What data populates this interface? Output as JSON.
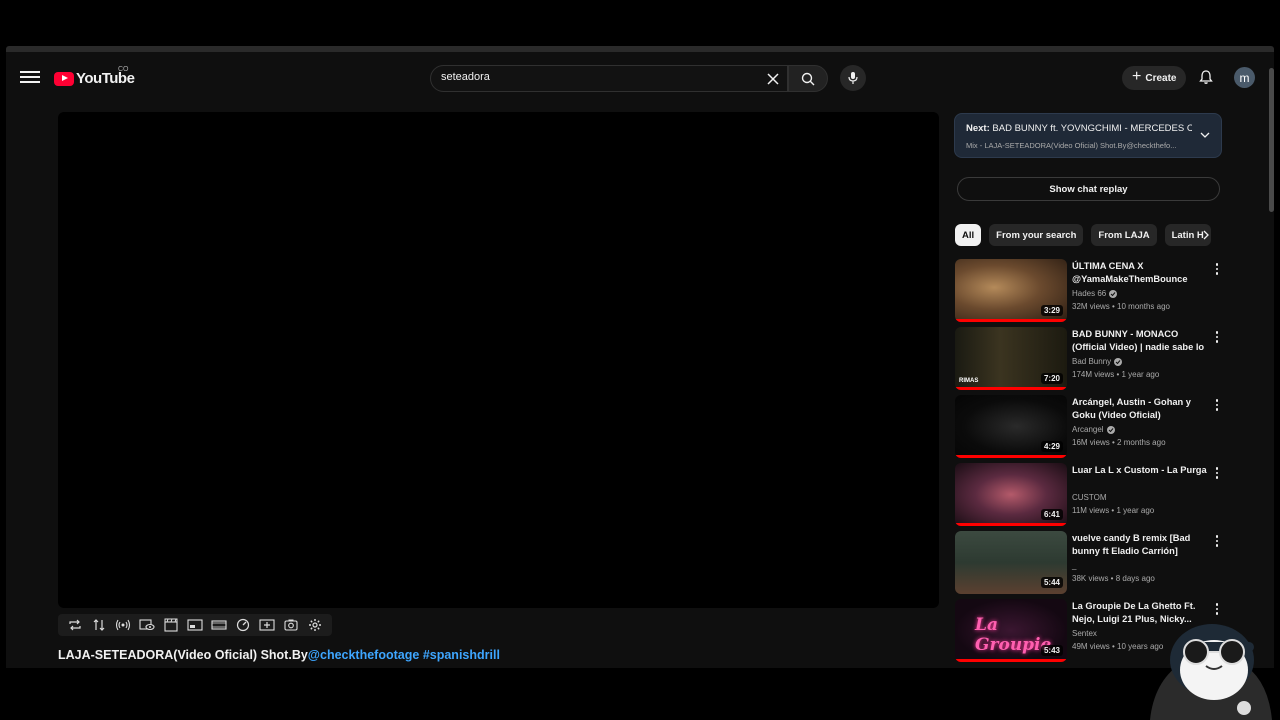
{
  "header": {
    "logo_text": "YouTube",
    "logo_region": "CO",
    "search": {
      "value": "seteadora"
    },
    "create_label": "Create",
    "avatar_letter": "m"
  },
  "video": {
    "title_main": "LAJA-SETEADORA(Video Oficial) Shot.By",
    "title_mention": "@checkthefootage",
    "title_hashtag": "#spanishdrill"
  },
  "next_card": {
    "prefix": "Next:",
    "title": "BAD BUNNY ft. YOVNGCHIMI - MERCEDES C...",
    "playlist": "Mix - LAJA-SETEADORA(Video Oficial) Shot.By@checkthefo..."
  },
  "chat_replay_label": "Show chat replay",
  "chips": [
    {
      "label": "All",
      "active": true
    },
    {
      "label": "From your search",
      "active": false
    },
    {
      "label": "From LAJA",
      "active": false
    },
    {
      "label": "Latin H",
      "active": false
    }
  ],
  "recommendations": [
    {
      "title": "ÚLTIMA CENA X @YamaMakeThemBounce",
      "channel": "Hades 66",
      "verified": true,
      "meta": "32M views • 10 months ago",
      "duration": "3:29",
      "thumb_label": "",
      "progress": 1.0
    },
    {
      "title": "BAD BUNNY - MONACO (Official Video) | nadie sabe lo que va a...",
      "channel": "Bad Bunny",
      "verified": true,
      "meta": "174M views • 1 year ago",
      "duration": "7:20",
      "thumb_label": "RIMAS",
      "progress": 1.0
    },
    {
      "title": "Arcángel, Austin - Gohan y Goku (Video Oficial)",
      "channel": "Arcangel",
      "verified": true,
      "meta": "16M views • 2 months ago",
      "duration": "4:29",
      "thumb_label": "",
      "progress": 1.0
    },
    {
      "title": "Luar La L x Custom - La Purga",
      "channel": "CUSTOM",
      "verified": false,
      "meta": "11M views • 1 year ago",
      "duration": "6:41",
      "thumb_label": "",
      "progress": 1.0
    },
    {
      "title": "vuelve candy B remix [Bad bunny ft Eladio Carrión]",
      "channel": "_",
      "verified": false,
      "meta": "38K views • 8 days ago",
      "duration": "5:44",
      "thumb_label": "",
      "progress": 0.0
    },
    {
      "title": "La Groupie De La Ghetto Ft. Nejo, Luigi 21 Plus, Nicky...",
      "channel": "Sentex",
      "verified": false,
      "meta": "49M views • 10 years ago",
      "duration": "5:43",
      "thumb_label": "",
      "progress": 1.0
    }
  ],
  "icons": {
    "player_tools": [
      "loop-icon",
      "sort-icon",
      "broadcast-icon",
      "view-icon",
      "clapper-icon",
      "pip-icon",
      "theater-icon",
      "speed-icon",
      "add-icon",
      "screenshot-icon",
      "settings-icon"
    ]
  },
  "colors": {
    "accent": "#ff0033",
    "link": "#3ea6ff",
    "background": "#0f0f0f"
  }
}
